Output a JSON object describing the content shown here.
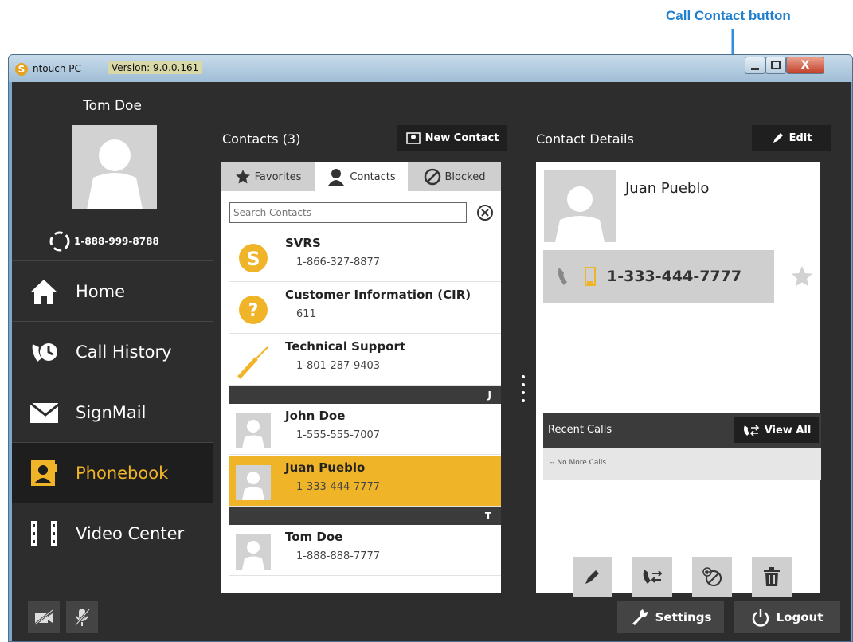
{
  "annotation": {
    "label": "Call Contact button"
  },
  "window": {
    "logo": "S",
    "title": "ntouch PC -",
    "version": "Version: 9.0.0.161",
    "close": "X"
  },
  "user": {
    "name": "Tom Doe",
    "number": "1-888-999-8788"
  },
  "nav": [
    {
      "label": "Home",
      "icon": "home-icon"
    },
    {
      "label": "Call History",
      "icon": "call-history-icon"
    },
    {
      "label": "SignMail",
      "icon": "envelope-icon"
    },
    {
      "label": "Phonebook",
      "icon": "phonebook-icon"
    },
    {
      "label": "Video Center",
      "icon": "film-icon"
    }
  ],
  "contacts_panel": {
    "title": "Contacts (3)",
    "new_contact": "New Contact",
    "tabs": [
      "Favorites",
      "Contacts",
      "Blocked"
    ],
    "search_placeholder": "Search Contacts",
    "rows": [
      {
        "name": "SVRS",
        "number": "1-866-327-8877"
      },
      {
        "name": "Customer Information (CIR)",
        "number": "611"
      },
      {
        "name": "Technical Support",
        "number": "1-801-287-9403"
      },
      {
        "name": "John Doe",
        "number": "1-555-555-7007"
      },
      {
        "name": "Juan Pueblo",
        "number": "1-333-444-7777"
      },
      {
        "name": "Tom Doe",
        "number": "1-888-888-7777"
      }
    ],
    "letters": [
      "J",
      "T"
    ]
  },
  "details_panel": {
    "title": "Contact Details",
    "edit": "Edit",
    "name": "Juan Pueblo",
    "phone": "1-333-444-7777",
    "recent_title": "Recent Calls",
    "view_all": "View All",
    "no_calls": "-- No More Calls"
  },
  "footer": {
    "settings": "Settings",
    "logout": "Logout"
  },
  "colors": {
    "accent": "#f0b428",
    "annotation": "#1e7fcf",
    "panel": "#3b3b3b"
  }
}
